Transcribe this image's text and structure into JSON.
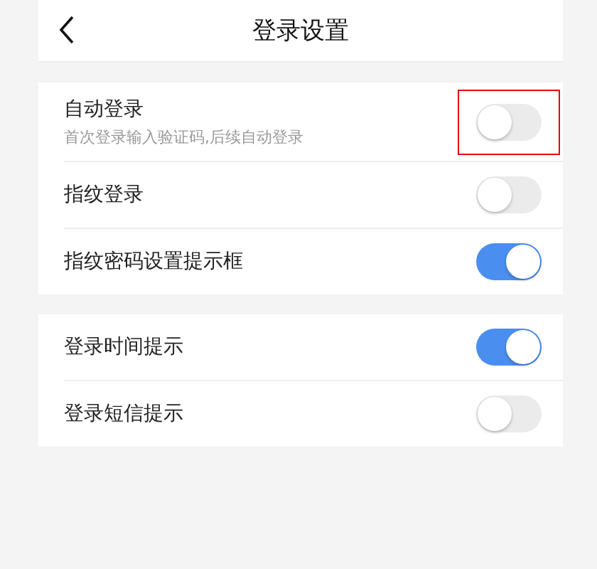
{
  "header": {
    "title": "登录设置"
  },
  "groups": [
    {
      "items": [
        {
          "label": "自动登录",
          "description": "首次登录输入验证码,后续自动登录",
          "on": false,
          "highlighted": true
        },
        {
          "label": "指纹登录",
          "on": false,
          "highlighted": false
        },
        {
          "label": "指纹密码设置提示框",
          "on": true,
          "highlighted": false
        }
      ]
    },
    {
      "items": [
        {
          "label": "登录时间提示",
          "on": true,
          "highlighted": false
        },
        {
          "label": "登录短信提示",
          "on": false,
          "highlighted": false
        }
      ]
    }
  ]
}
